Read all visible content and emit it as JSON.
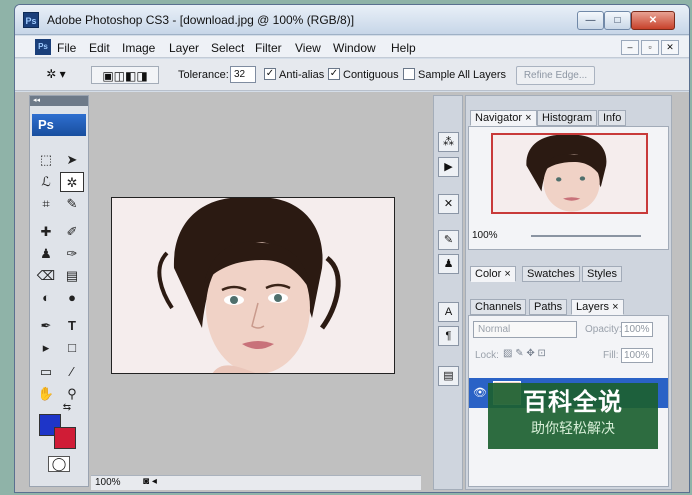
{
  "window": {
    "app_icon": "Ps",
    "title": "Adobe Photoshop CS3 - [download.jpg @ 100% (RGB/8)]",
    "min_glyph": "—",
    "max_glyph": "□",
    "close_glyph": "✕"
  },
  "menubar": {
    "doc_icon": "Ps",
    "items": [
      "File",
      "Edit",
      "Image",
      "Layer",
      "Select",
      "Filter",
      "View",
      "Window",
      "Help"
    ],
    "doc_min": "–",
    "doc_restore": "▫",
    "doc_close": "✕"
  },
  "options": {
    "tolerance_label": "Tolerance:",
    "tolerance_value": "32",
    "antialias_label": "Anti-alias",
    "antialias_checked": "✓",
    "contiguous_label": "Contiguous",
    "contiguous_checked": "✓",
    "sample_all_label": "Sample All Layers",
    "refine_edge_label": "Refine Edge..."
  },
  "toolbox": {
    "logo": "Ps",
    "collapse": "◂◂"
  },
  "document": {
    "zoom": "100%"
  },
  "panels": {
    "navigator_tabs": [
      "Navigator",
      "Histogram",
      "Info"
    ],
    "navigator_zoom": "100%",
    "color_tabs": [
      "Color",
      "Swatches",
      "Styles"
    ],
    "layers_tabs": [
      "Channels",
      "Paths",
      "Layers"
    ],
    "blend_mode": "Normal",
    "opacity_label": "Opacity:",
    "opacity_value": "100%",
    "lock_label": "Lock:",
    "fill_label": "Fill:",
    "fill_value": "100%"
  },
  "watermark": {
    "big": "百科全说",
    "small": "助你轻松解决"
  },
  "colors": {
    "foreground": "#1e35c8",
    "background": "#d01c36",
    "layer_selected": "#2a62c6"
  }
}
